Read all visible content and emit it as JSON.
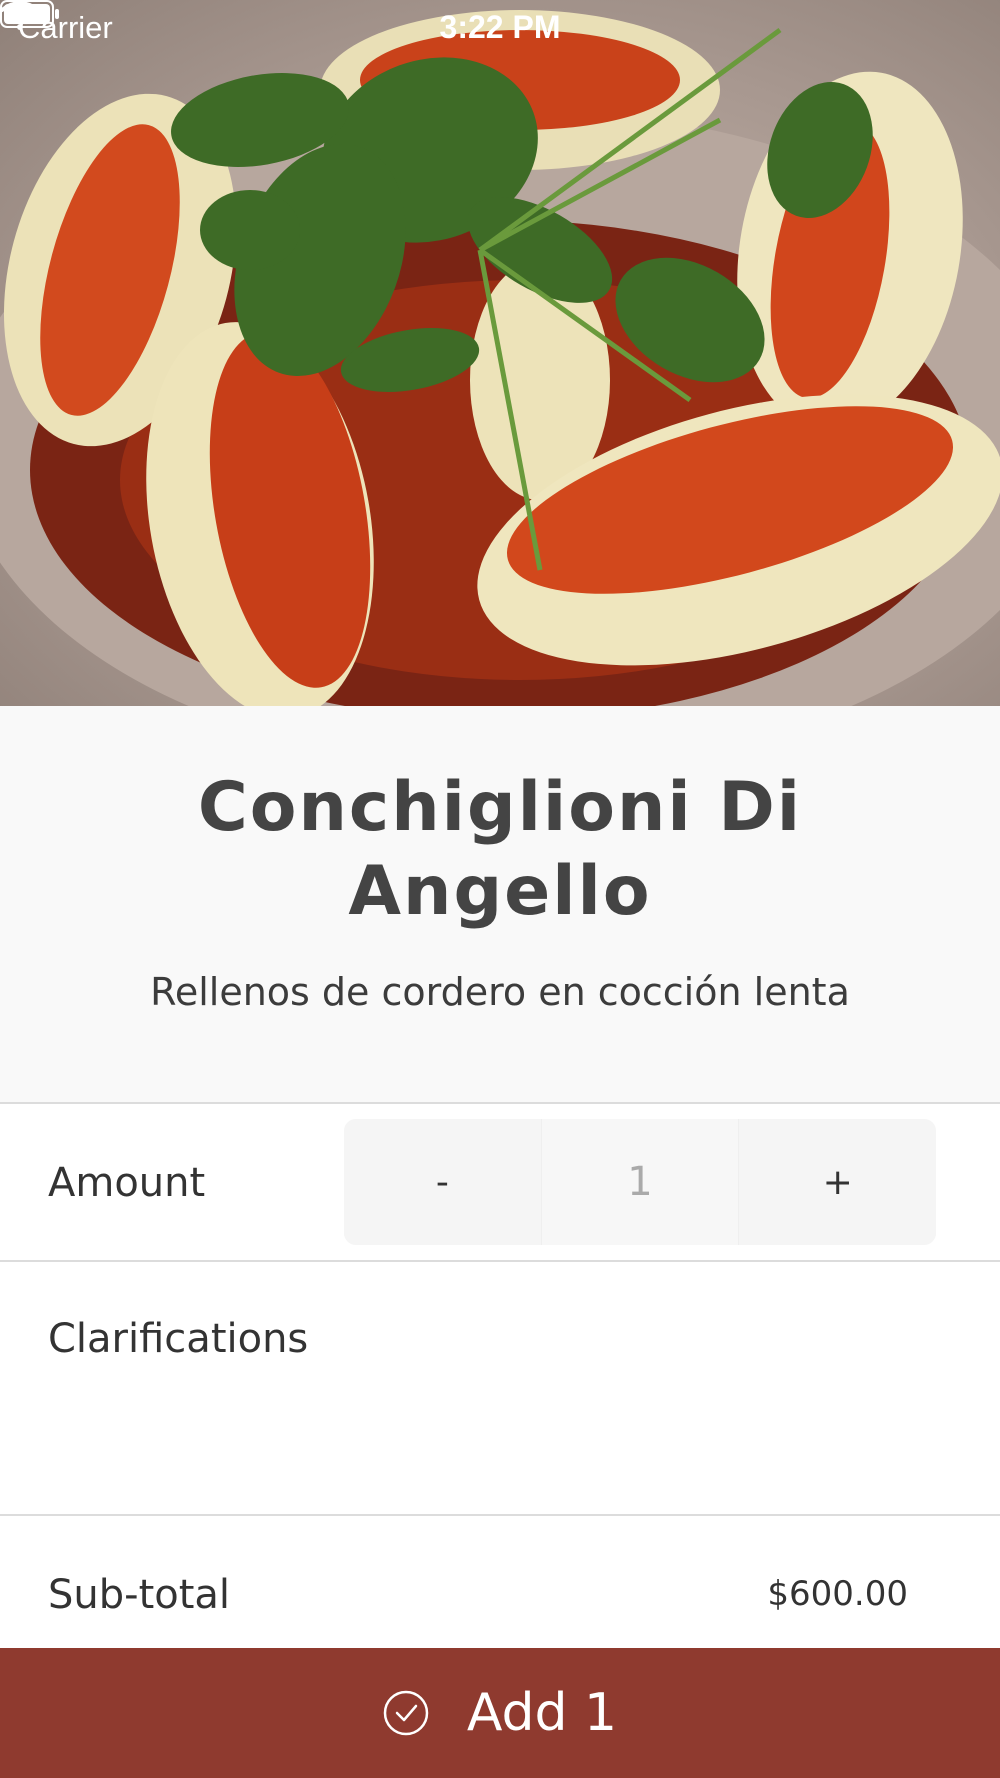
{
  "status_bar": {
    "carrier": "Carrier",
    "time": "3:22 PM",
    "icons": [
      "wifi-icon",
      "battery-icon"
    ]
  },
  "hero": {
    "image": "dish-photo-conchiglioni"
  },
  "dish": {
    "title": "Conchiglioni Di Angello",
    "description": "Rellenos de cordero en cocción lenta"
  },
  "amount": {
    "label": "Amount",
    "decrement": "-",
    "value": "1",
    "increment": "+"
  },
  "clarifications": {
    "label": "Clarifications",
    "value": ""
  },
  "subtotal": {
    "label": "Sub-total",
    "value": "$600.00"
  },
  "add_button": {
    "label": "Add 1",
    "icon": "check-circle-icon"
  },
  "colors": {
    "accent": "#8f3a2f",
    "title": "#444444",
    "divider": "#dcdcdc"
  }
}
